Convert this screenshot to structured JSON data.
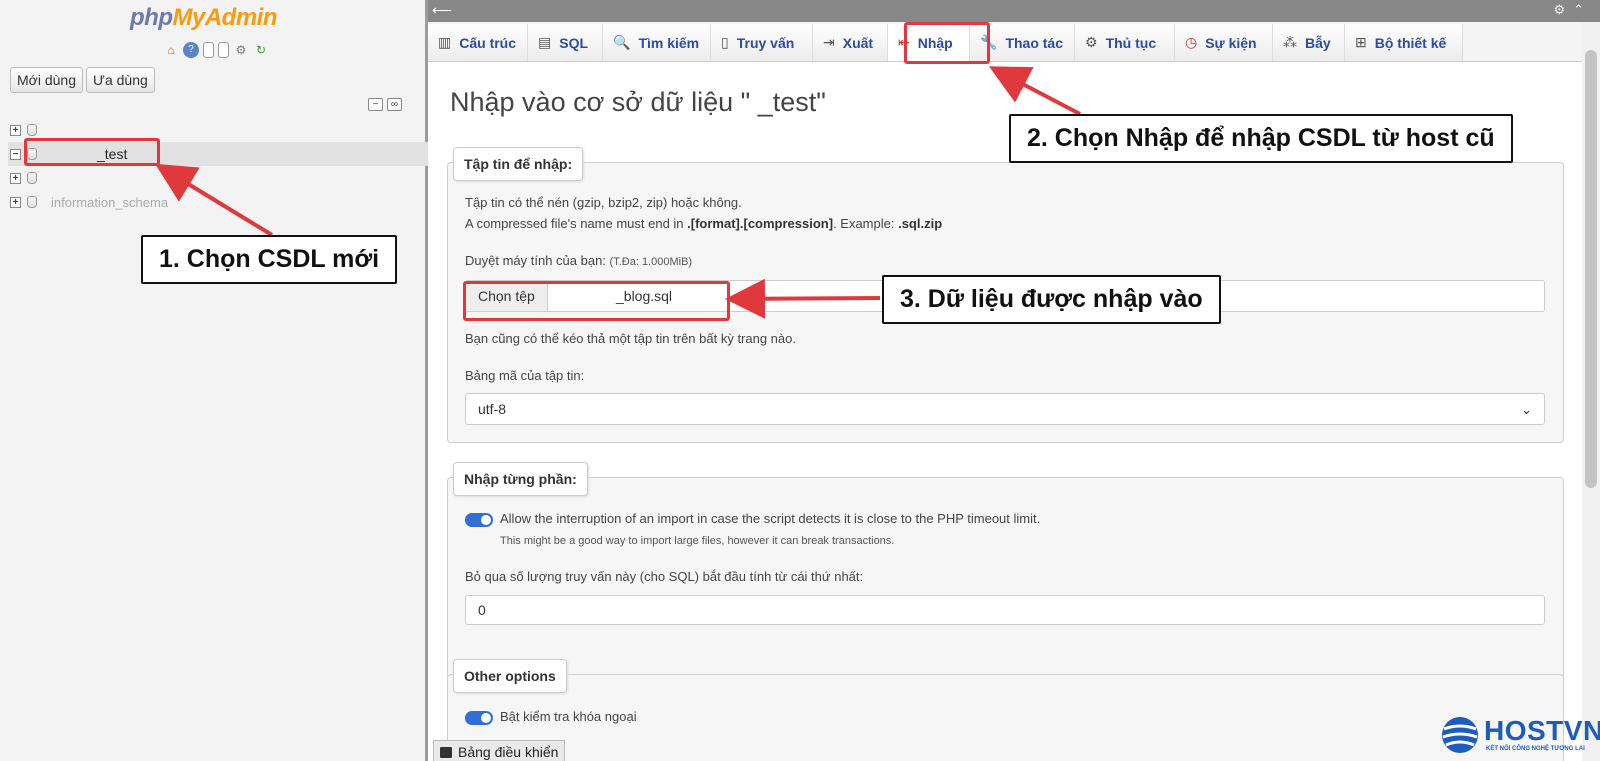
{
  "nav": {
    "logo_a": "php",
    "logo_b": "MyAdmin",
    "icons": [
      "home-icon",
      "help-icon",
      "docs-icon",
      "copy-icon",
      "settings-icon",
      "reload-icon"
    ],
    "tabs": [
      "Mới dùng",
      "Ưa dùng"
    ],
    "tree": [
      {
        "name": "",
        "selected": false
      },
      {
        "name": "_test",
        "selected": true
      },
      {
        "name": "",
        "selected": false
      },
      {
        "name": "information_schema",
        "selected": false
      }
    ]
  },
  "tabs": [
    {
      "label": "Cấu trúc",
      "icon": "structure-icon",
      "glyph": "▥"
    },
    {
      "label": "SQL",
      "icon": "sql-icon",
      "glyph": "▤"
    },
    {
      "label": "Tìm kiếm",
      "icon": "search-icon",
      "glyph": "🔍"
    },
    {
      "label": "Truy vấn",
      "icon": "query-icon",
      "glyph": "▯"
    },
    {
      "label": "Xuất",
      "icon": "export-icon",
      "glyph": "⇥"
    },
    {
      "label": "Nhập",
      "icon": "import-icon",
      "glyph": "⇤"
    },
    {
      "label": "Thao tác",
      "icon": "wrench-icon",
      "glyph": "🔧"
    },
    {
      "label": "Thủ tục",
      "icon": "routines-icon",
      "glyph": "⚙"
    },
    {
      "label": "Sự kiện",
      "icon": "events-icon",
      "glyph": "◷"
    },
    {
      "label": "Bẫy",
      "icon": "triggers-icon",
      "glyph": "⁂"
    },
    {
      "label": "Bộ thiết kế",
      "icon": "designer-icon",
      "glyph": "⊞"
    }
  ],
  "main": {
    "title": "Nhập vào cơ sở dữ liệu \"           _test\"",
    "file_section": {
      "legend": "Tập tin để nhập:",
      "compress_note": "Tập tin có thể nén (gzip, bzip2, zip) hoặc không.",
      "compress_note2_pre": "A compressed file's name must end in ",
      "compress_note2_fmt": ".[format].[compression]",
      "compress_note2_mid": ". Example: ",
      "compress_note2_ex": ".sql.zip",
      "browse_label": "Duyệt máy tính của bạn:",
      "max_size": "(T.Đa: 1.000MiB)",
      "choose_file_btn": "Chọn tệp",
      "file_name": "_blog.sql",
      "drag_hint": "Bạn cũng có thể kéo thả một tập tin trên bất kỳ trang nào.",
      "charset_label": "Bảng mã của tập tin:",
      "charset_value": "utf-8"
    },
    "partial_section": {
      "legend": "Nhập từng phần:",
      "allow_interrupt": "Allow the interruption of an import in case the script detects it is close to the PHP timeout limit.",
      "allow_interrupt_note": "This might be a good way to import large files, however it can break transactions.",
      "skip_label": "Bỏ qua số lượng truy vấn này (cho SQL) bắt đầu tính từ cái thứ nhất:",
      "skip_value": "0"
    },
    "other_section": {
      "legend": "Other options",
      "foreign_keys": "Bật kiểm tra khóa ngoại"
    }
  },
  "console_label": "Bảng điều khiển",
  "annotations": {
    "step1": "1. Chọn CSDL mới",
    "step2": "2. Chọn Nhập để nhập CSDL từ host cũ",
    "step3": "3. Dữ liệu được nhập vào",
    "color": "#e0393d"
  },
  "brand": {
    "name": "HOSTVN",
    "tagline": "KẾT NỐI CÔNG NGHỆ TƯƠNG LAI",
    "color": "#1e5bbf"
  }
}
